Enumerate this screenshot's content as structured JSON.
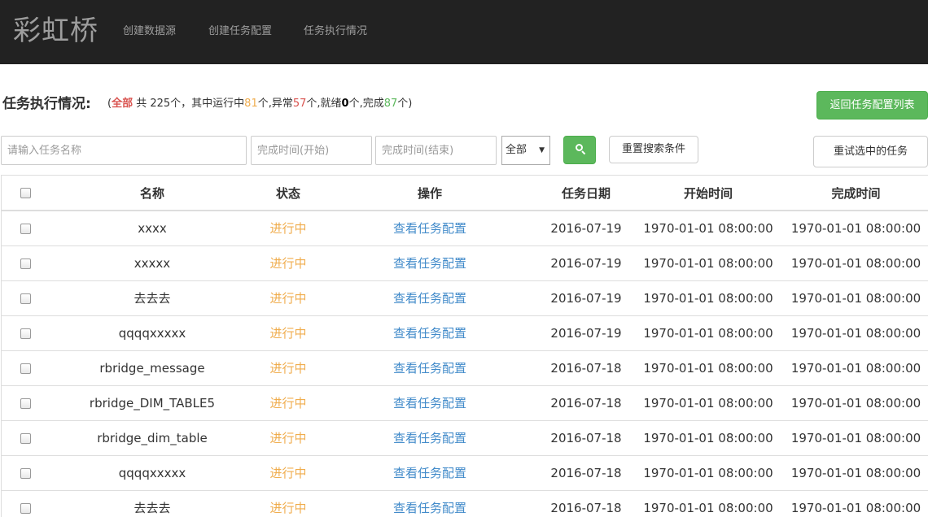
{
  "navbar": {
    "brand": "彩虹桥",
    "links": [
      "创建数据源",
      "创建任务配置",
      "任务执行情况"
    ]
  },
  "header": {
    "title": "任务执行情况:",
    "summary": {
      "open_paren": "(",
      "all_label": "全部",
      "total_text": " 共 225个，其中运行中",
      "running": "81",
      "after_running": "个,异常",
      "error": "57",
      "after_error": "个,就绪",
      "ready": "0",
      "after_ready": "个,完成",
      "done": "87",
      "after_done": "个)"
    },
    "back_button": "返回任务配置列表"
  },
  "filters": {
    "name_placeholder": "请输入任务名称",
    "start_placeholder": "完成时间(开始)",
    "end_placeholder": "完成时间(结束)",
    "status_select": "全部",
    "reset_button": "重置搜索条件",
    "retry_button": "重试选中的任务"
  },
  "table": {
    "headers": [
      "名称",
      "状态",
      "操作",
      "任务日期",
      "开始时间",
      "完成时间"
    ],
    "rows": [
      {
        "name": "xxxx",
        "status": "进行中",
        "action": "查看任务配置",
        "date": "2016-07-19",
        "start": "1970-01-01 08:00:00",
        "end": "1970-01-01 08:00:00"
      },
      {
        "name": "xxxxx",
        "status": "进行中",
        "action": "查看任务配置",
        "date": "2016-07-19",
        "start": "1970-01-01 08:00:00",
        "end": "1970-01-01 08:00:00"
      },
      {
        "name": "去去去",
        "status": "进行中",
        "action": "查看任务配置",
        "date": "2016-07-19",
        "start": "1970-01-01 08:00:00",
        "end": "1970-01-01 08:00:00"
      },
      {
        "name": "qqqqxxxxx",
        "status": "进行中",
        "action": "查看任务配置",
        "date": "2016-07-19",
        "start": "1970-01-01 08:00:00",
        "end": "1970-01-01 08:00:00"
      },
      {
        "name": "rbridge_message",
        "status": "进行中",
        "action": "查看任务配置",
        "date": "2016-07-18",
        "start": "1970-01-01 08:00:00",
        "end": "1970-01-01 08:00:00"
      },
      {
        "name": "rbridge_DIM_TABLE5",
        "status": "进行中",
        "action": "查看任务配置",
        "date": "2016-07-18",
        "start": "1970-01-01 08:00:00",
        "end": "1970-01-01 08:00:00"
      },
      {
        "name": "rbridge_dim_table",
        "status": "进行中",
        "action": "查看任务配置",
        "date": "2016-07-18",
        "start": "1970-01-01 08:00:00",
        "end": "1970-01-01 08:00:00"
      },
      {
        "name": "qqqqxxxxx",
        "status": "进行中",
        "action": "查看任务配置",
        "date": "2016-07-18",
        "start": "1970-01-01 08:00:00",
        "end": "1970-01-01 08:00:00"
      },
      {
        "name": "去去去",
        "status": "进行中",
        "action": "查看任务配置",
        "date": "2016-07-18",
        "start": "1970-01-01 08:00:00",
        "end": "1970-01-01 08:00:00"
      }
    ]
  },
  "colors": {
    "navbar": "#222222",
    "success": "#5cb85c",
    "status_running": "#f0ad4e",
    "link": "#428bca",
    "danger": "#d9534f"
  },
  "icons": {
    "search_button": "search-icon"
  }
}
